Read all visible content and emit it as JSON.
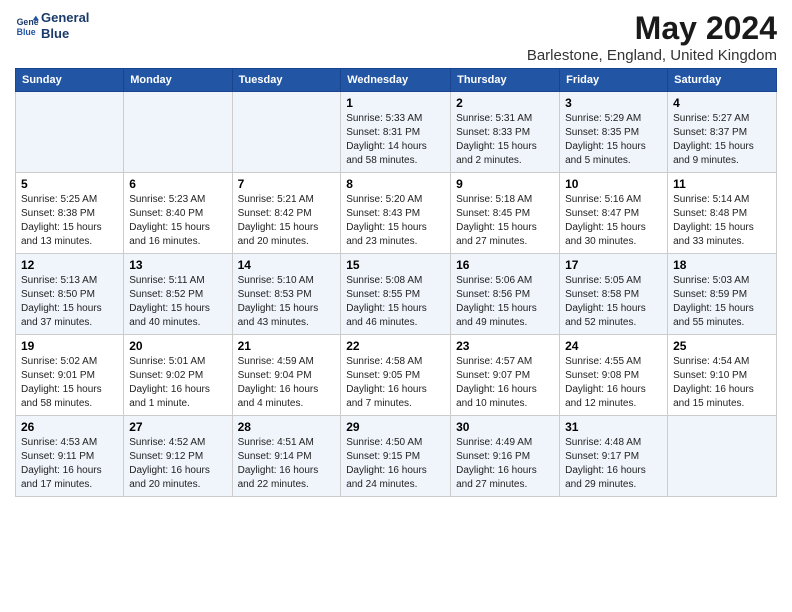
{
  "logo": {
    "line1": "General",
    "line2": "Blue"
  },
  "title": "May 2024",
  "subtitle": "Barlestone, England, United Kingdom",
  "days_header": [
    "Sunday",
    "Monday",
    "Tuesday",
    "Wednesday",
    "Thursday",
    "Friday",
    "Saturday"
  ],
  "weeks": [
    [
      {
        "num": "",
        "info": ""
      },
      {
        "num": "",
        "info": ""
      },
      {
        "num": "",
        "info": ""
      },
      {
        "num": "1",
        "info": "Sunrise: 5:33 AM\nSunset: 8:31 PM\nDaylight: 14 hours\nand 58 minutes."
      },
      {
        "num": "2",
        "info": "Sunrise: 5:31 AM\nSunset: 8:33 PM\nDaylight: 15 hours\nand 2 minutes."
      },
      {
        "num": "3",
        "info": "Sunrise: 5:29 AM\nSunset: 8:35 PM\nDaylight: 15 hours\nand 5 minutes."
      },
      {
        "num": "4",
        "info": "Sunrise: 5:27 AM\nSunset: 8:37 PM\nDaylight: 15 hours\nand 9 minutes."
      }
    ],
    [
      {
        "num": "5",
        "info": "Sunrise: 5:25 AM\nSunset: 8:38 PM\nDaylight: 15 hours\nand 13 minutes."
      },
      {
        "num": "6",
        "info": "Sunrise: 5:23 AM\nSunset: 8:40 PM\nDaylight: 15 hours\nand 16 minutes."
      },
      {
        "num": "7",
        "info": "Sunrise: 5:21 AM\nSunset: 8:42 PM\nDaylight: 15 hours\nand 20 minutes."
      },
      {
        "num": "8",
        "info": "Sunrise: 5:20 AM\nSunset: 8:43 PM\nDaylight: 15 hours\nand 23 minutes."
      },
      {
        "num": "9",
        "info": "Sunrise: 5:18 AM\nSunset: 8:45 PM\nDaylight: 15 hours\nand 27 minutes."
      },
      {
        "num": "10",
        "info": "Sunrise: 5:16 AM\nSunset: 8:47 PM\nDaylight: 15 hours\nand 30 minutes."
      },
      {
        "num": "11",
        "info": "Sunrise: 5:14 AM\nSunset: 8:48 PM\nDaylight: 15 hours\nand 33 minutes."
      }
    ],
    [
      {
        "num": "12",
        "info": "Sunrise: 5:13 AM\nSunset: 8:50 PM\nDaylight: 15 hours\nand 37 minutes."
      },
      {
        "num": "13",
        "info": "Sunrise: 5:11 AM\nSunset: 8:52 PM\nDaylight: 15 hours\nand 40 minutes."
      },
      {
        "num": "14",
        "info": "Sunrise: 5:10 AM\nSunset: 8:53 PM\nDaylight: 15 hours\nand 43 minutes."
      },
      {
        "num": "15",
        "info": "Sunrise: 5:08 AM\nSunset: 8:55 PM\nDaylight: 15 hours\nand 46 minutes."
      },
      {
        "num": "16",
        "info": "Sunrise: 5:06 AM\nSunset: 8:56 PM\nDaylight: 15 hours\nand 49 minutes."
      },
      {
        "num": "17",
        "info": "Sunrise: 5:05 AM\nSunset: 8:58 PM\nDaylight: 15 hours\nand 52 minutes."
      },
      {
        "num": "18",
        "info": "Sunrise: 5:03 AM\nSunset: 8:59 PM\nDaylight: 15 hours\nand 55 minutes."
      }
    ],
    [
      {
        "num": "19",
        "info": "Sunrise: 5:02 AM\nSunset: 9:01 PM\nDaylight: 15 hours\nand 58 minutes."
      },
      {
        "num": "20",
        "info": "Sunrise: 5:01 AM\nSunset: 9:02 PM\nDaylight: 16 hours\nand 1 minute."
      },
      {
        "num": "21",
        "info": "Sunrise: 4:59 AM\nSunset: 9:04 PM\nDaylight: 16 hours\nand 4 minutes."
      },
      {
        "num": "22",
        "info": "Sunrise: 4:58 AM\nSunset: 9:05 PM\nDaylight: 16 hours\nand 7 minutes."
      },
      {
        "num": "23",
        "info": "Sunrise: 4:57 AM\nSunset: 9:07 PM\nDaylight: 16 hours\nand 10 minutes."
      },
      {
        "num": "24",
        "info": "Sunrise: 4:55 AM\nSunset: 9:08 PM\nDaylight: 16 hours\nand 12 minutes."
      },
      {
        "num": "25",
        "info": "Sunrise: 4:54 AM\nSunset: 9:10 PM\nDaylight: 16 hours\nand 15 minutes."
      }
    ],
    [
      {
        "num": "26",
        "info": "Sunrise: 4:53 AM\nSunset: 9:11 PM\nDaylight: 16 hours\nand 17 minutes."
      },
      {
        "num": "27",
        "info": "Sunrise: 4:52 AM\nSunset: 9:12 PM\nDaylight: 16 hours\nand 20 minutes."
      },
      {
        "num": "28",
        "info": "Sunrise: 4:51 AM\nSunset: 9:14 PM\nDaylight: 16 hours\nand 22 minutes."
      },
      {
        "num": "29",
        "info": "Sunrise: 4:50 AM\nSunset: 9:15 PM\nDaylight: 16 hours\nand 24 minutes."
      },
      {
        "num": "30",
        "info": "Sunrise: 4:49 AM\nSunset: 9:16 PM\nDaylight: 16 hours\nand 27 minutes."
      },
      {
        "num": "31",
        "info": "Sunrise: 4:48 AM\nSunset: 9:17 PM\nDaylight: 16 hours\nand 29 minutes."
      },
      {
        "num": "",
        "info": ""
      }
    ]
  ]
}
